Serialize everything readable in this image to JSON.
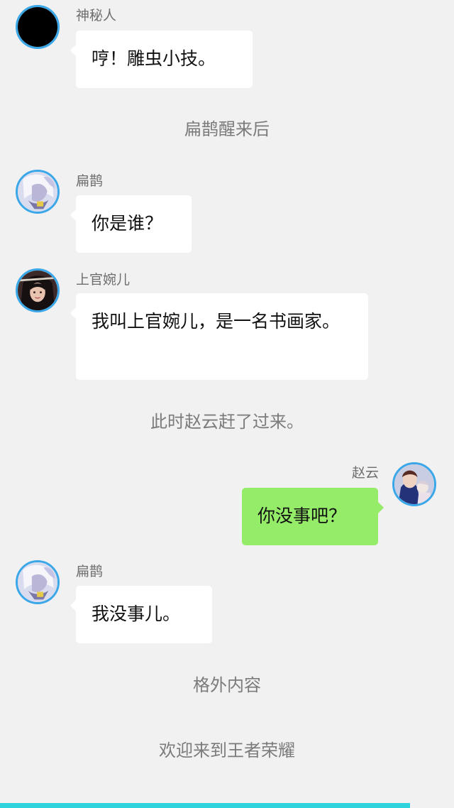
{
  "messages": [
    {
      "sender": "神秘人",
      "text": "哼！雕虫小技。",
      "avatar": "black-avatar"
    },
    {
      "system": "扁鹊醒来后"
    },
    {
      "sender": "扁鹊",
      "text": "你是谁？",
      "avatar": "bianque-avatar"
    },
    {
      "sender": "上官婉儿",
      "text": "我叫上官婉儿，是一名书画家。",
      "avatar": "shangguan-avatar"
    },
    {
      "system": "此时赵云赶了过来。"
    },
    {
      "sender": "赵云",
      "text": "你没事吧？",
      "avatar": "zhaoyun-avatar"
    },
    {
      "sender": "扁鹊",
      "text": "我没事儿。",
      "avatar": "bianque-avatar"
    },
    {
      "system": "格外内容"
    },
    {
      "system": "欢迎来到王者荣耀"
    }
  ],
  "colors": {
    "background": "#f1f1f1",
    "left_bubble": "#ffffff",
    "right_bubble": "#95ec69",
    "avatar_border": "#3aa7e8",
    "bottom_bar": "#2fd3dd"
  }
}
